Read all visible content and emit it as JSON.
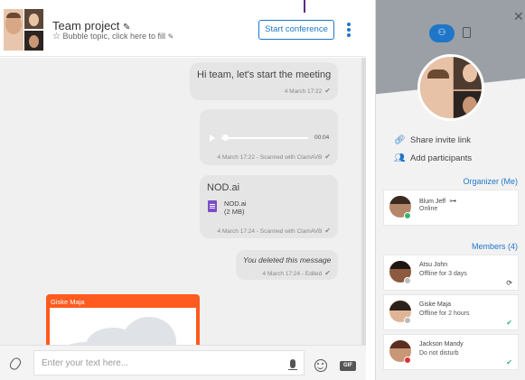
{
  "header": {
    "title": "Team project",
    "subtitle": "Bubble topic, click here to fill",
    "start_conference_label": "Start conference"
  },
  "messages": [
    {
      "text": "Hi team, let's start the meeting",
      "meta": "4 March 17:22"
    },
    {
      "type": "audio",
      "duration": "00:04",
      "progress": 0.0,
      "meta": "4 March 17:22 - Scanned with ClamAVB"
    },
    {
      "file_title": "NOD.ai",
      "file_name": "NOD.ai",
      "file_size": "(2 MB)",
      "meta": "4 March 17:24 - Scanned with ClamAVB"
    },
    {
      "text": "You deleted this message",
      "meta": "4 March 17:24 - Edited"
    },
    {
      "sender": "Giske Maja"
    }
  ],
  "composer": {
    "placeholder": "Enter your text here...",
    "gif_label": "GIF"
  },
  "panel": {
    "share_invite_label": "Share invite link",
    "add_participants_label": "Add participants",
    "organizer_heading": "Organizer (Me)",
    "organizer": {
      "name": "Blum Jeff",
      "status": "Online",
      "status_color": "#3cb371"
    },
    "members_heading": "Members (4)",
    "members": [
      {
        "name": "Atsu John",
        "status": "Offline for 3 days",
        "status_color": "#bbbbbb"
      },
      {
        "name": "Giske Maja",
        "status": "Offline for 2 hours",
        "status_color": "#bbbbbb"
      },
      {
        "name": "Jackson Mandy",
        "status": "Do not disturb",
        "status_color": "#e0312f"
      }
    ]
  },
  "colors": {
    "accent": "#1f76c8",
    "card_header": "#ff5a1f",
    "bubble": "#e5e5e5"
  },
  "icons": [
    "pencil-icon",
    "star-icon",
    "kebab-menu-icon",
    "play-icon",
    "check-icon",
    "document-icon",
    "paperclip-icon",
    "microphone-icon",
    "emoji-icon",
    "gif-icon",
    "close-icon",
    "people-tab-icon",
    "files-tab-icon",
    "link-icon",
    "add-person-icon",
    "key-icon",
    "sync-icon"
  ]
}
